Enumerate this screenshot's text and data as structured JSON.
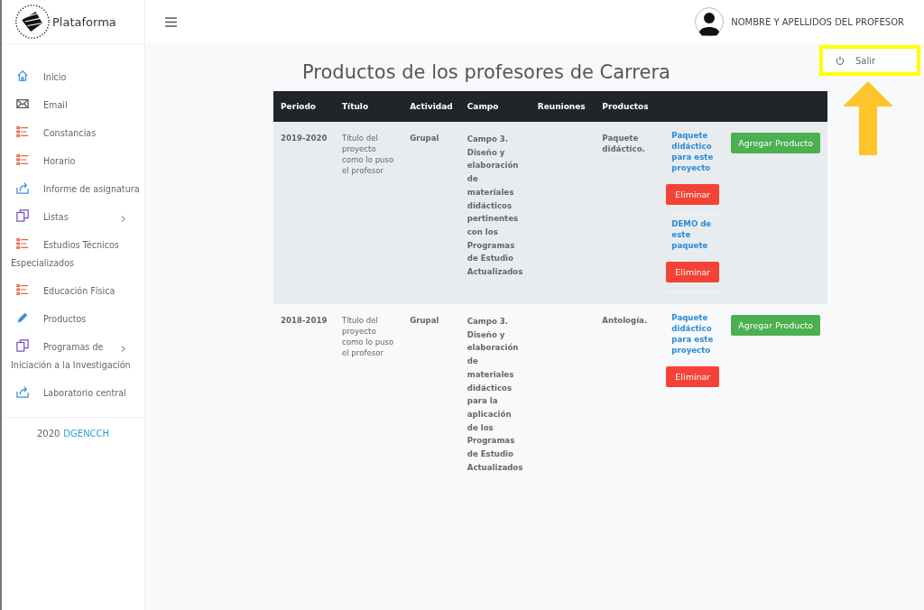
{
  "brand": {
    "name": "Plataforma"
  },
  "sidebar": {
    "items": [
      {
        "label": "Inicio",
        "kind": "home",
        "submenu": false
      },
      {
        "label": "Email",
        "kind": "mail",
        "submenu": false
      },
      {
        "label": "Constancias",
        "kind": "list",
        "submenu": false
      },
      {
        "label": "Horario",
        "kind": "list",
        "submenu": false
      },
      {
        "label": "Informe de asignatura",
        "kind": "share",
        "submenu": false
      },
      {
        "label": "Listas",
        "kind": "copy",
        "submenu": true
      },
      {
        "label": "Estudios Técnicos Especializados",
        "kind": "list",
        "submenu": false
      },
      {
        "label": "Educación Física",
        "kind": "list",
        "submenu": false
      },
      {
        "label": "Productos",
        "kind": "pencil",
        "submenu": false
      },
      {
        "label": "Programas de Iniciación a la Investigación",
        "kind": "copy",
        "submenu": true
      },
      {
        "label": "Laboratorio central",
        "kind": "share",
        "submenu": false
      }
    ],
    "footer": {
      "year": "2020",
      "link": "DGENCCH"
    }
  },
  "header": {
    "user_name": "NOMBRE Y APELLIDOS DEL PROFESOR"
  },
  "user_menu": {
    "items": [
      {
        "label": "Salir",
        "highlighted": true
      }
    ]
  },
  "page_title": "Productos de los profesores de Carrera",
  "table": {
    "columns": [
      "Periodo",
      "Título",
      "Actividad",
      "Campo",
      "Reuniones",
      "Productos"
    ],
    "rows": [
      {
        "periodo": "2019-2020",
        "titulo": "Título del proyecto como lo puso el profesor",
        "actividad": "Grupal",
        "campo": "Campo 3. Diseño y elaboración de materiales didácticos pertinentes con los Programas de Estudio Actualizados",
        "producto": "Paquete didáctico.",
        "items": [
          {
            "link": "Paquete didáctico para este proyecto",
            "button": "Eliminar"
          },
          {
            "link": "DEMO de este paquete",
            "button": "Eliminar"
          }
        ],
        "add_button": "Agregar Producto"
      },
      {
        "periodo": "2018-2019",
        "titulo": "Título del proyecto como lo puso el profesor",
        "actividad": "Grupal",
        "campo": "Campo 3. Diseño y elaboración de materiales didácticos para la aplicación de los Programas de Estudio Actualizados",
        "producto": "Antología.",
        "items": [
          {
            "link": "Paquete didáctico para este proyecto",
            "button": "Eliminar"
          }
        ],
        "add_button": "Agregar Producto"
      }
    ]
  }
}
